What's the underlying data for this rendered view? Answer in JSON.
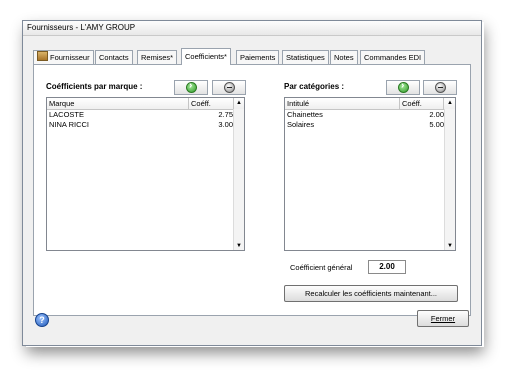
{
  "window": {
    "title": "Fournisseurs - L'AMY GROUP"
  },
  "tabs": [
    {
      "label": "Fournisseur"
    },
    {
      "label": "Contacts"
    },
    {
      "label": "Remises*"
    },
    {
      "label": "Coefficients*"
    },
    {
      "label": "Paiements"
    },
    {
      "label": "Statistiques"
    },
    {
      "label": "Notes"
    },
    {
      "label": "Commandes EDI"
    }
  ],
  "active_tab": "Coefficients*",
  "by_brand": {
    "label": "Coéfficients par marque :",
    "columns": [
      "Marque",
      "Coéff."
    ],
    "rows": [
      {
        "name": "LACOSTE",
        "coef": "2.75"
      },
      {
        "name": "NINA RICCI",
        "coef": "3.00"
      }
    ]
  },
  "by_category": {
    "label": "Par catégories :",
    "columns": [
      "Intitulé",
      "Coéff."
    ],
    "rows": [
      {
        "name": "Chainettes",
        "coef": "2.00"
      },
      {
        "name": "Solaires",
        "coef": "5.00"
      }
    ]
  },
  "general": {
    "label": "Coéfficient général",
    "value": "2.00"
  },
  "buttons": {
    "recalc": "Recalculer les coéfficients maintenant...",
    "close": "Fermer"
  },
  "icons": {
    "add": "add-green-icon",
    "remove": "remove-grey-icon",
    "help": "help-icon",
    "tab_first": "supplier-icon"
  },
  "colors": {
    "accent_green": "#2f9b28",
    "help_blue": "#1b56b8"
  }
}
